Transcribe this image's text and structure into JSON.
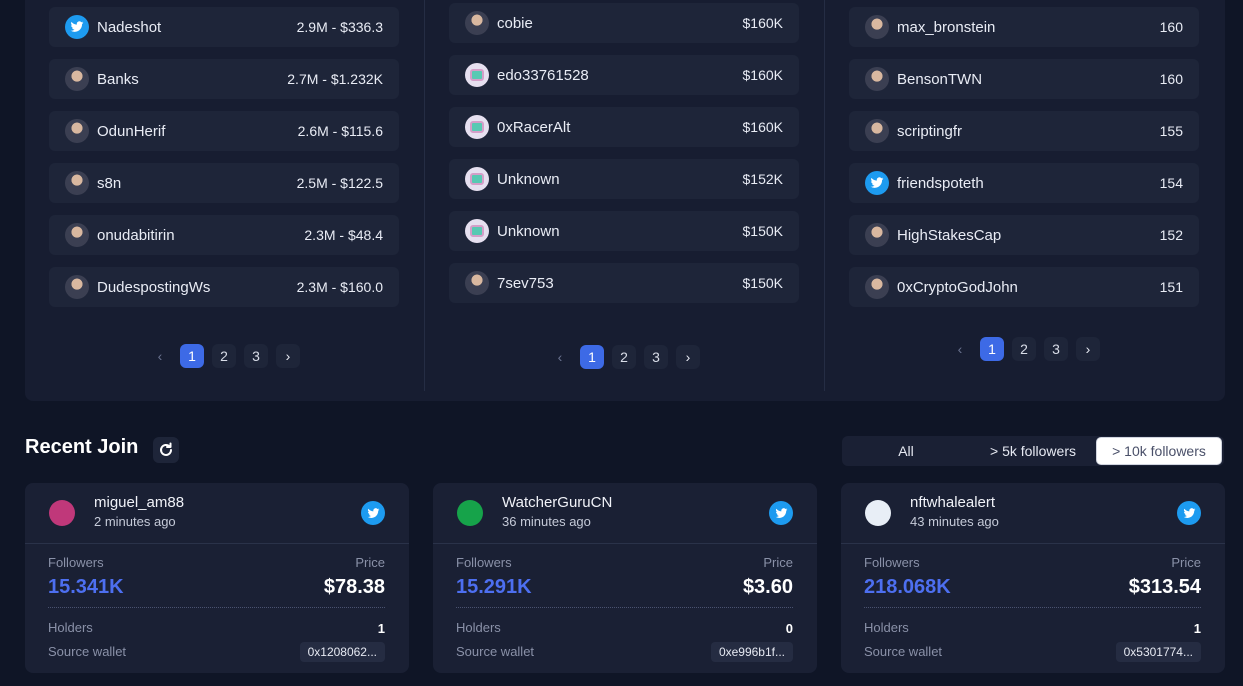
{
  "columns": [
    {
      "rows": [
        {
          "name": "Nadeshot",
          "value": "2.9M - $336.3",
          "avatar": "twitter-icon"
        },
        {
          "name": "Banks",
          "value": "2.7M - $1.232K",
          "avatar": "user-avatar"
        },
        {
          "name": "OdunHerif",
          "value": "2.6M - $115.6",
          "avatar": "user-avatar"
        },
        {
          "name": "s8n",
          "value": "2.5M - $122.5",
          "avatar": "user-avatar"
        },
        {
          "name": "onudabitirin",
          "value": "2.3M - $48.4",
          "avatar": "user-avatar"
        },
        {
          "name": "DudespostingWs",
          "value": "2.3M - $160.0",
          "avatar": "user-avatar"
        }
      ]
    },
    {
      "rows": [
        {
          "name": "cobie",
          "value": "$160K",
          "avatar": "user-avatar"
        },
        {
          "name": "edo33761528",
          "value": "$160K",
          "avatar": "default-avatar"
        },
        {
          "name": "0xRacerAlt",
          "value": "$160K",
          "avatar": "default-avatar"
        },
        {
          "name": "Unknown",
          "value": "$152K",
          "avatar": "default-avatar"
        },
        {
          "name": "Unknown",
          "value": "$150K",
          "avatar": "default-avatar"
        },
        {
          "name": "7sev753",
          "value": "$150K",
          "avatar": "user-avatar"
        }
      ]
    },
    {
      "rows": [
        {
          "name": "max_bronstein",
          "value": "160",
          "avatar": "user-avatar"
        },
        {
          "name": "BensonTWN",
          "value": "160",
          "avatar": "user-avatar"
        },
        {
          "name": "scriptingfr",
          "value": "155",
          "avatar": "user-avatar"
        },
        {
          "name": "friendspoteth",
          "value": "154",
          "avatar": "twitter-icon"
        },
        {
          "name": "HighStakesCap",
          "value": "152",
          "avatar": "user-avatar"
        },
        {
          "name": "0xCryptoGodJohn",
          "value": "151",
          "avatar": "user-avatar"
        }
      ]
    }
  ],
  "pagination": {
    "pages": [
      "1",
      "2",
      "3"
    ],
    "current": "1",
    "prev": "‹",
    "next": "›"
  },
  "recent": {
    "title": "Recent Join",
    "filters": [
      "All",
      "> 5k followers",
      "> 10k followers"
    ],
    "selected_filter": "> 10k followers",
    "labels": {
      "followers": "Followers",
      "price": "Price",
      "holders": "Holders",
      "source_wallet": "Source wallet"
    },
    "cards": [
      {
        "name": "miguel_am88",
        "time": "2 minutes ago",
        "followers": "15.341K",
        "price": "$78.38",
        "holders": "1",
        "wallet": "0x1208062...",
        "avatar_color": "#c0387a"
      },
      {
        "name": "WatcherGuruCN",
        "time": "36 minutes ago",
        "followers": "15.291K",
        "price": "$3.60",
        "holders": "0",
        "wallet": "0xe996b1f...",
        "avatar_color": "#16a34a"
      },
      {
        "name": "nftwhalealert",
        "time": "43 minutes ago",
        "followers": "218.068K",
        "price": "$313.54",
        "holders": "1",
        "wallet": "0x5301774...",
        "avatar_color": "#e8eef6"
      }
    ]
  },
  "colors": {
    "accent": "#3d6ae6",
    "followers_blue": "#4d6ff0",
    "twitter": "#1d9bf0"
  }
}
